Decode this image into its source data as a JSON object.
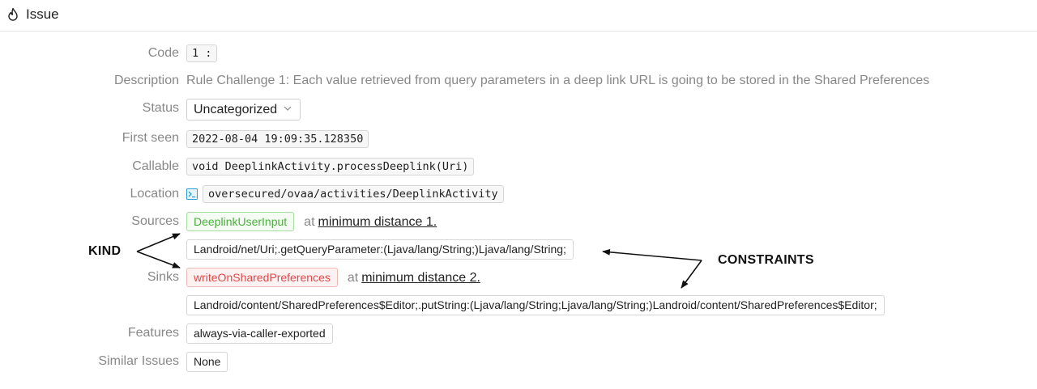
{
  "header": {
    "title": "Issue",
    "icon": "flame-icon"
  },
  "fields": {
    "code": {
      "label": "Code",
      "value": "1 :"
    },
    "description": {
      "label": "Description",
      "value": "Rule Challenge 1: Each value retrieved from query parameters in a deep link URL is going to be stored in the Shared Preferences"
    },
    "status": {
      "label": "Status",
      "value": "Uncategorized"
    },
    "first_seen": {
      "label": "First seen",
      "value": "2022-08-04 19:09:35.128350"
    },
    "callable": {
      "label": "Callable",
      "value": "void DeeplinkActivity.processDeeplink(Uri)"
    },
    "location": {
      "label": "Location",
      "value": "oversecured/ovaa/activities/DeeplinkActivity",
      "icon": "terminal-icon"
    },
    "sources": {
      "label": "Sources",
      "kind": "DeeplinkUserInput",
      "at": "at",
      "distance": "minimum distance 1.",
      "constraint": "Landroid/net/Uri;.getQueryParameter:(Ljava/lang/String;)Ljava/lang/String;"
    },
    "sinks": {
      "label": "Sinks",
      "kind": "writeOnSharedPreferences",
      "at": "at",
      "distance": "minimum distance 2.",
      "constraint": "Landroid/content/SharedPreferences$Editor;.putString:(Ljava/lang/String;Ljava/lang/String;)Landroid/content/SharedPreferences$Editor;"
    },
    "features": {
      "label": "Features",
      "value": "always-via-caller-exported"
    },
    "similar_issues": {
      "label": "Similar Issues",
      "value": "None"
    }
  },
  "annotations": {
    "kind": "KIND",
    "constraints": "CONSTRAINTS"
  },
  "colors": {
    "source": "#4cae3f",
    "sink": "#e0484a",
    "label": "#888888",
    "location_icon": "#2a9fd6"
  }
}
